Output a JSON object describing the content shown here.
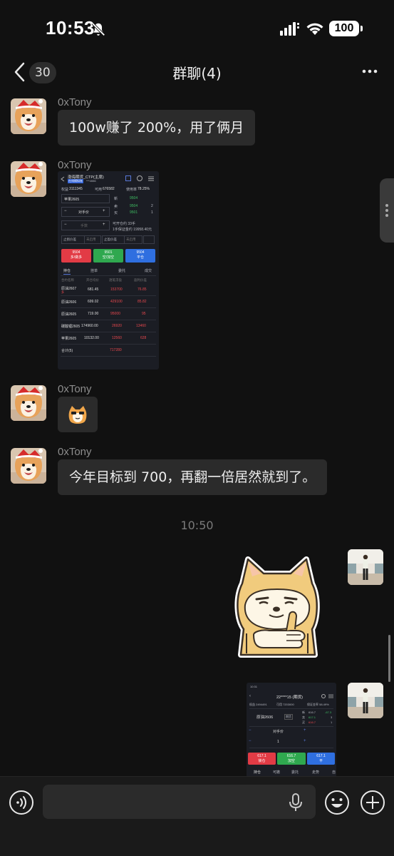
{
  "status_bar": {
    "time": "10:53",
    "battery": "100"
  },
  "nav": {
    "unread_count": "30",
    "title": "群聊(4)"
  },
  "messages": [
    {
      "sender": "0xTony",
      "text": "100w赚了 200%，用了俩月"
    },
    {
      "sender": "0xTony"
    },
    {
      "sender": "0xTony"
    },
    {
      "sender": "0xTony",
      "text": "今年目标到 700，再翻一倍居然就到了。"
    }
  ],
  "time_divider": "10:50",
  "trade_shot_1": {
    "account": "渤海期货_CTP(主席)",
    "account_id": "***4556",
    "equity_label": "权益",
    "equity": "3111345",
    "available_label": "可用",
    "available": "676582",
    "usage_label": "使用率",
    "usage": "78.25%",
    "instrument": "苹果2605",
    "price_mode": "对手价",
    "lots_placeholder": "手数",
    "stop_profit": "止损价差",
    "stop_loss": "止盈价差",
    "unused1": "未启用",
    "unused2": "未启用",
    "orderbook": [
      {
        "label": "新",
        "price": "9504",
        "vol": ""
      },
      {
        "label": "卖",
        "price": "9504",
        "vol": "2"
      },
      {
        "label": "买",
        "price": "9501",
        "vol": "1"
      }
    ],
    "can_open": "可开仓约 33手",
    "margin": "1手保证金约 19958.40元",
    "buttons": [
      {
        "price": "9504",
        "label": "多/做多",
        "color": "#e23b45"
      },
      {
        "price": "9501",
        "label": "空/加空",
        "color": "#2fa84f"
      },
      {
        "price": "9504",
        "label": "平仓",
        "color": "#2f6fe0"
      }
    ],
    "tabs": [
      "持仓",
      "挂单",
      "委托",
      "成交"
    ],
    "headers": [
      "合约名称",
      "开仓均价",
      "逐笔浮盈",
      "盈利价差"
    ],
    "rows": [
      {
        "name": "原油2607",
        "sub": "多",
        "avg": "681.45",
        "pnl": "153700",
        "diff": "76.85"
      },
      {
        "name": "原油2606",
        "sub": "",
        "avg": "699.02",
        "pnl": "429100",
        "diff": "85.82"
      },
      {
        "name": "原油2605",
        "sub": "",
        "avg": "719.00",
        "pnl": "95000",
        "diff": "95"
      },
      {
        "name": "碳酸锂2605",
        "sub": "",
        "avg": "174960.00",
        "pnl": "26920",
        "diff": "13460"
      },
      {
        "name": "苹果2605",
        "sub": "",
        "avg": "10132.00",
        "pnl": "12560",
        "diff": "628"
      }
    ],
    "total_label": "合计(5)",
    "total": "717280"
  },
  "trade_shot_2": {
    "status_time": "10:31",
    "account": "22****15 (期货)",
    "equity": "权益 2494491",
    "available": "可用 7203000",
    "usage": "保证金率 58.49%",
    "instrument": "原油2606",
    "tag": "期货",
    "price_mode": "对手价",
    "lots": "1",
    "orderbook": [
      {
        "label": "新",
        "price": "616.7",
        "vol": "-67.3"
      },
      {
        "label": "卖",
        "price": "617.1",
        "vol": "3"
      },
      {
        "label": "买",
        "price": "616.7",
        "vol": "1"
      }
    ],
    "buttons": [
      {
        "price": "617.1",
        "label": "锁仓",
        "color": "#e23b45"
      },
      {
        "price": "616.7",
        "label": "加空",
        "color": "#2fa84f"
      },
      {
        "price": "617.1",
        "label": "平",
        "color": "#2f6fe0"
      }
    ],
    "tabs": [
      "持仓",
      "可撤",
      "委托",
      "走势",
      "自"
    ]
  }
}
